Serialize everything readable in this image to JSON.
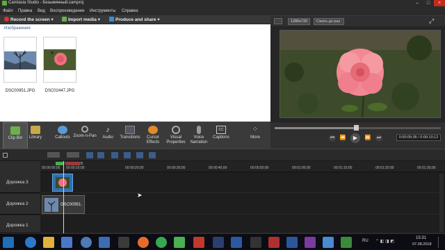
{
  "window": {
    "title": "Camtasia Studio - Безымянный.camproj"
  },
  "menu": [
    "Файл",
    "Правка",
    "Вид",
    "Воспроизведение",
    "Инструменты",
    "Справка"
  ],
  "toolbar": {
    "record": "Record the screen",
    "import": "Import media",
    "produce": "Produce and share"
  },
  "clip_bin": {
    "section": "Изображения",
    "items": [
      {
        "label": "DSC00951.JPG"
      },
      {
        "label": "DSC02447.JPG"
      }
    ]
  },
  "preview": {
    "resolution": "1280x720",
    "fit_placeholder": "Сжать до раз"
  },
  "tasks": [
    {
      "label": "Clip Bin",
      "icon": "clip-bin-icon",
      "active": true
    },
    {
      "label": "Library",
      "icon": "library-icon"
    },
    {
      "label": "Callouts",
      "icon": "callouts-icon"
    },
    {
      "label": "Zoom-n-Pan",
      "icon": "zoom-icon"
    },
    {
      "label": "Audio",
      "icon": "audio-icon"
    },
    {
      "label": "Transitions",
      "icon": "transitions-icon"
    },
    {
      "label": "Cursor Effects",
      "icon": "cursor-icon"
    },
    {
      "label": "Visual Properties",
      "icon": "visual-icon"
    },
    {
      "label": "Voice Narration",
      "icon": "mic-icon"
    },
    {
      "label": "Captions",
      "icon": "captions-icon"
    },
    {
      "label": "More",
      "icon": "more-icon"
    }
  ],
  "playback": {
    "time": "0:00:05;05 / 0:00:10;12"
  },
  "timeline": {
    "ticks": [
      "00:00:00;00",
      "00:00:05;05",
      "00:00:10;00",
      "00:00:20;00",
      "00:00:30;00",
      "00:00:40;00",
      "00:00:50;00",
      "00:01:00;00",
      "00:01:10;00",
      "00:01:20;00",
      "00:01:30;00"
    ],
    "tracks": [
      {
        "name": "Дорожка 3"
      },
      {
        "name": "Дорожка 2",
        "clip_label": "DSC00951."
      },
      {
        "name": "Дорожка 1"
      }
    ]
  },
  "taskbar": {
    "lang": "RU",
    "time": "15:31",
    "date": "07.08.2018"
  }
}
